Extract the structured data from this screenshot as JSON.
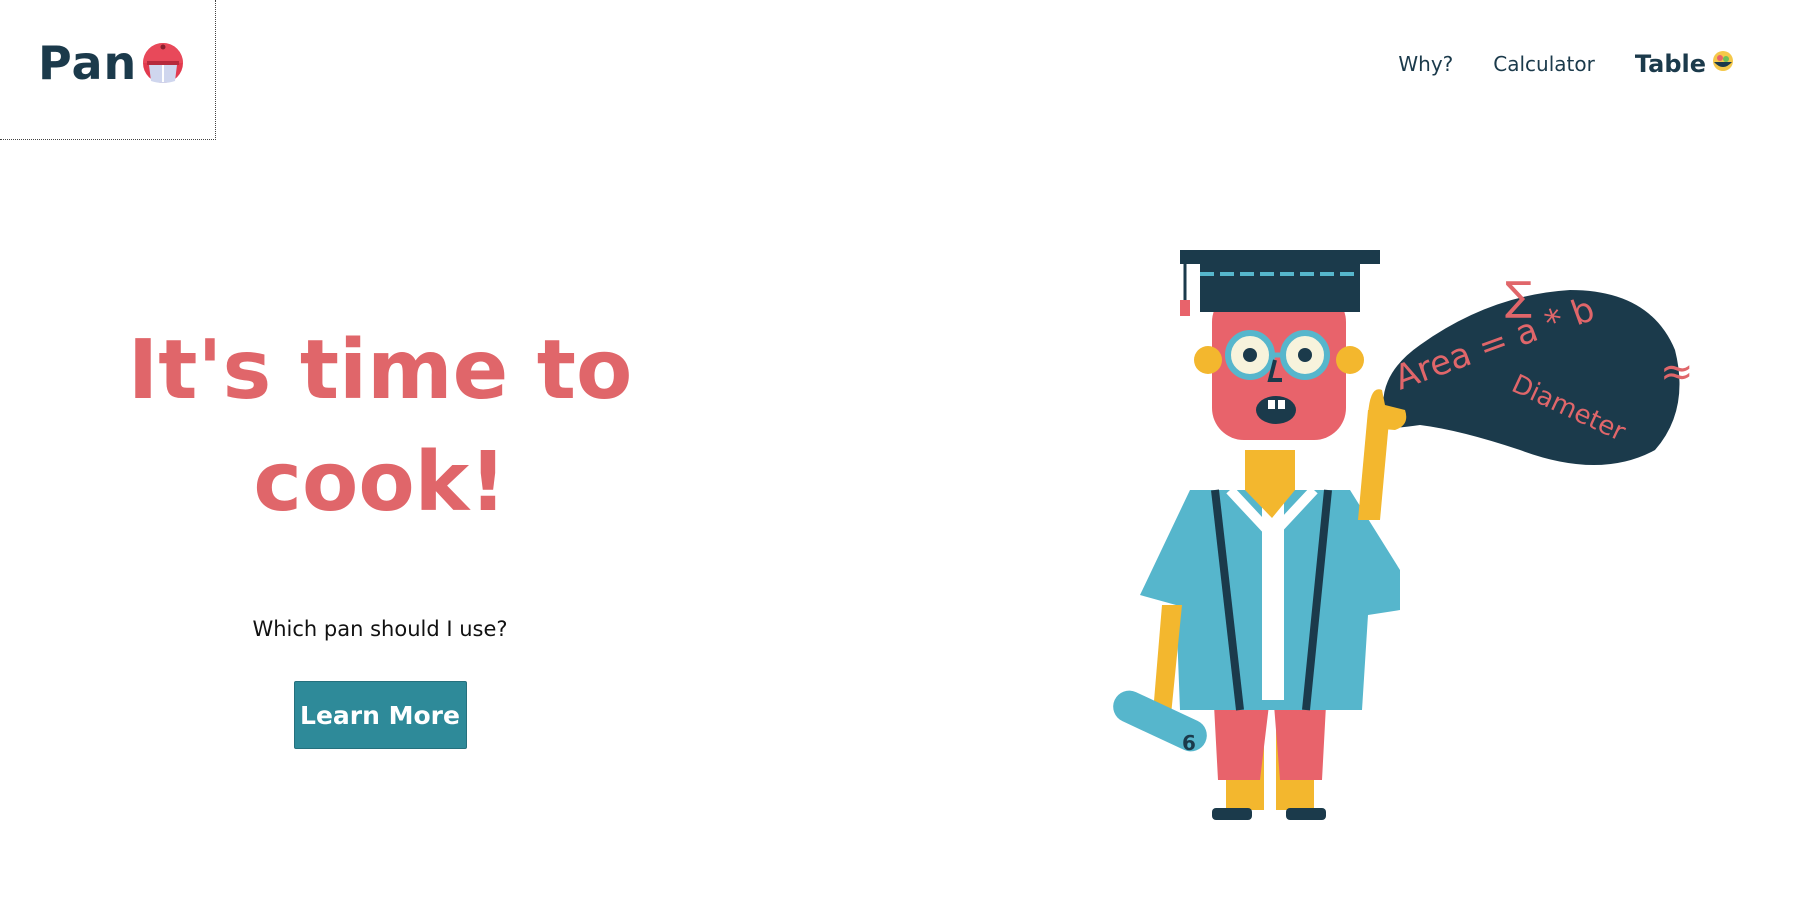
{
  "header": {
    "logo_text": "Pan"
  },
  "nav": {
    "items": [
      {
        "label": "Why?"
      },
      {
        "label": "Calculator"
      },
      {
        "label": "Table"
      }
    ]
  },
  "hero": {
    "title_line1": "It's time to",
    "title_line2": "cook!",
    "subtitle": "Which pan should I use?",
    "cta_label": "Learn More"
  },
  "illustration": {
    "bubble_text_area": "Area = a * b",
    "bubble_text_diameter": "Diameter",
    "sigma_symbol": "∑",
    "approx_symbol": "≈",
    "scroll_number": "6"
  },
  "colors": {
    "brand_dark": "#1b3a4b",
    "accent_red": "#e0666a",
    "button_teal": "#2e8a99",
    "gown_blue": "#56b6cc",
    "skin_yellow": "#f3b72e",
    "pants_red": "#e8636b"
  },
  "icons": {
    "logo": "red-pot-icon",
    "table_nav": "food-bowl-icon"
  }
}
